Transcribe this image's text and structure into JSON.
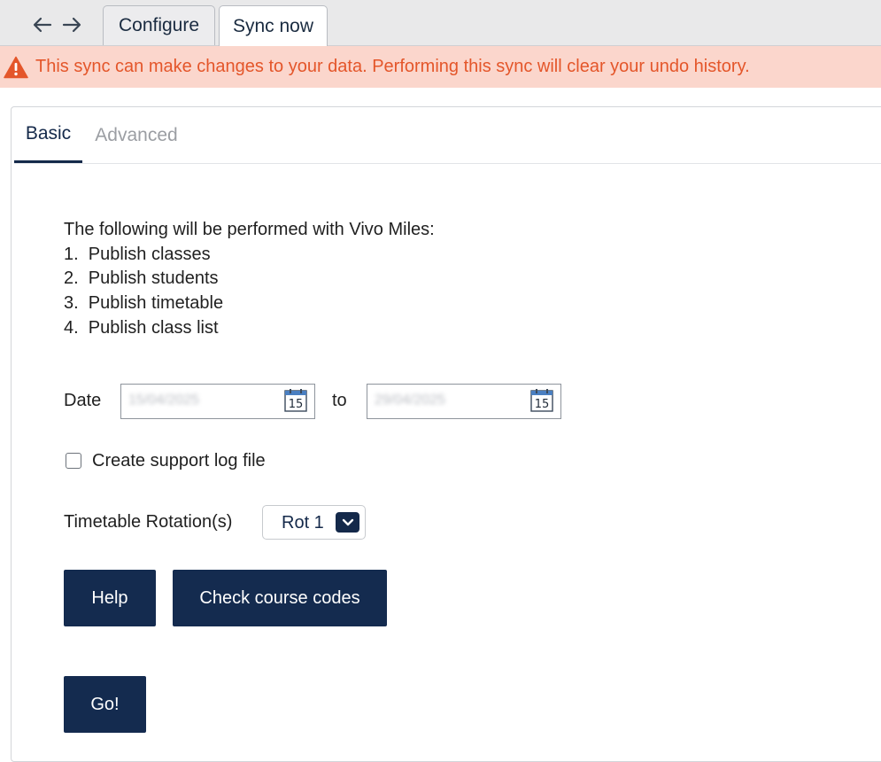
{
  "toolbar": {
    "back_icon": "arrow-left-icon",
    "forward_icon": "arrow-right-icon",
    "tabs": [
      {
        "label": "Configure",
        "active": false
      },
      {
        "label": "Sync now",
        "active": true
      }
    ]
  },
  "warning": {
    "icon": "warning-triangle-icon",
    "text": "This sync can make changes to your data. Performing this sync will clear your undo history.",
    "color": "#e4562a",
    "background": "#fbd6cc"
  },
  "subtabs": [
    {
      "label": "Basic",
      "active": true
    },
    {
      "label": "Advanced",
      "active": false
    }
  ],
  "intro": {
    "heading": "The following will be performed with Vivo Miles:",
    "steps": [
      "1.  Publish classes",
      "2.  Publish students",
      "3.  Publish timetable",
      "4.  Publish class list"
    ]
  },
  "date_range": {
    "label": "Date",
    "separator": "to",
    "from_value": "15/04/2025",
    "to_value": "29/04/2025",
    "calendar_day": "15",
    "calendar_icon": "calendar-icon"
  },
  "support_log": {
    "label": "Create support log file",
    "checked": false
  },
  "rotation": {
    "label": "Timetable Rotation(s)",
    "selected": "Rot 1",
    "icon": "chevron-down-icon"
  },
  "buttons": {
    "help": "Help",
    "check_codes": "Check course codes",
    "go": "Go!"
  },
  "colors": {
    "primary": "#142b4f",
    "accent_text": "#14294a"
  }
}
